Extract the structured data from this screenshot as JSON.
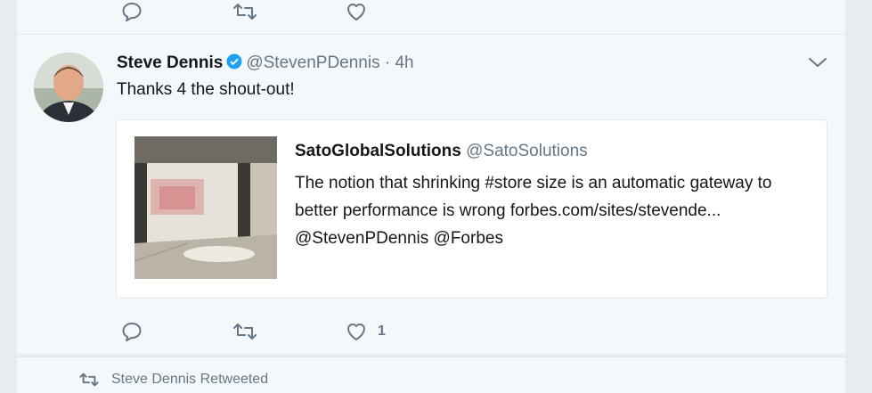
{
  "top_tweet": {
    "actions": {
      "reply_count": "",
      "retweet_count": "",
      "like_count": ""
    }
  },
  "tweet": {
    "display_name": "Steve Dennis",
    "handle": "@StevenPDennis",
    "separator": "·",
    "time": "4h",
    "text": "Thanks 4 the shout-out!",
    "quote": {
      "display_name": "SatoGlobalSolutions",
      "handle": "@SatoSolutions",
      "text": "The notion that shrinking #store size is an automatic gateway to better performance is wrong forbes.com/sites/stevende... @StevenPDennis @Forbes"
    },
    "actions": {
      "reply_count": "",
      "retweet_count": "",
      "like_count": "1"
    }
  },
  "retweet_banner": {
    "text": "Steve Dennis Retweeted"
  },
  "colors": {
    "background": "#e6ecf0",
    "card": "#f5f8fa",
    "secondary_text": "#657786",
    "verified_blue": "#1da1f2"
  },
  "icons": [
    "reply-icon",
    "retweet-icon",
    "like-icon",
    "verified-badge-icon",
    "chevron-down-icon"
  ]
}
